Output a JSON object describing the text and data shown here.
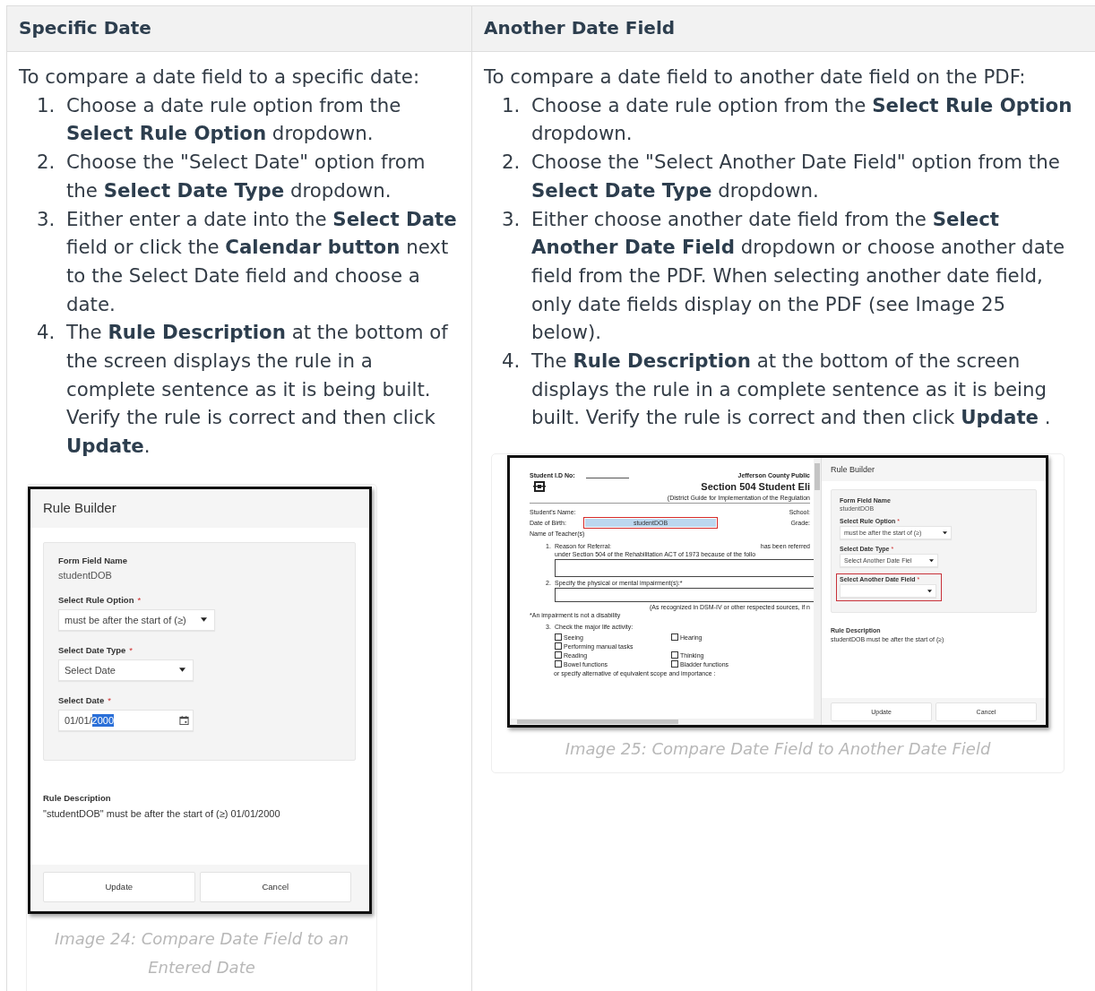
{
  "table": {
    "columns": [
      {
        "title": "Specific Date"
      },
      {
        "title": "Another Date Field"
      }
    ],
    "cells": [
      {
        "intro": "To compare a date field to a specific date:",
        "steps": [
          {
            "number": "1.",
            "text": "Choose a date rule option from the **Select Rule Option** dropdown."
          },
          {
            "number": "2.",
            "text": "Choose the \"Select Date\" option from the **Select Date Type** dropdown."
          },
          {
            "number": "3.",
            "text": "Either enter a date into the **Select Date** field or click the **Calendar button** next to the Select Date field and choose a date."
          },
          {
            "number": "4.",
            "text": "The **Rule Description** at the bottom of the screen displays the rule in a complete sentence as it is being built. Verify the rule is correct and then click **Update**."
          }
        ],
        "figure": {
          "kind": "dialog",
          "caption": "Image 24: Compare Date Field to an Entered Date",
          "dialog": {
            "title": "Rule Builder",
            "fields": [
              {
                "kind": "text",
                "label": "Form Field Name",
                "value": "studentDOB",
                "highlighted": false
              },
              {
                "kind": "select",
                "label": "Select Rule Option",
                "mark": "*",
                "value": "must be after the start of (≥)",
                "highlighted": false
              },
              {
                "kind": "select",
                "label": "Select Date Type",
                "mark": "*",
                "value": "Select Date",
                "highlighted": false
              },
              {
                "kind": "date",
                "label": "Select Date",
                "mark": "*",
                "value": "01/01/",
                "selected_text": "2000",
                "highlighted": false
              }
            ],
            "description_label": "Rule Description",
            "description": "\"studentDOB\" must be after the start of (≥) 01/01/2000",
            "buttons": [
              "Update",
              "Cancel"
            ]
          }
        }
      },
      {
        "intro": "To compare a date field to another date field on the PDF:",
        "steps": [
          {
            "number": "1.",
            "text": "Choose a date rule option from the **Select Rule Option** dropdown."
          },
          {
            "number": "2.",
            "text": "Choose the \"Select Another Date Field\" option from the **Select Date Type** dropdown."
          },
          {
            "number": "3.",
            "text": "Either choose another date field from the **Select Another Date Field** dropdown or choose another date field from the PDF. When selecting another date field, only date fields display on the PDF (see Image 25 below)."
          },
          {
            "number": "4.",
            "text": "The  **Rule Description**  at the bottom of the screen displays the rule in a complete sentence as it is being built. Verify the rule is correct and then click  **Update** ."
          }
        ],
        "figure": {
          "kind": "pdf_split",
          "caption": "Image 25: Compare Date Field to Another Date Field",
          "pdf": {
            "id_label": "Student I.D No:",
            "org": "Jefferson County Public",
            "title": "Section 504 Student Eli",
            "subtitle": "(District Guide for Implementation of the Regulation",
            "rows": [
              {
                "label": "Student's Name:",
                "right_label": "School:"
              },
              {
                "label": "Date of Birth:",
                "field": "studentDOB",
                "right_label": "Grade:"
              },
              {
                "label": "Name of Teacher(s)"
              }
            ],
            "q1": {
              "number": "1.",
              "label": "Reason for Referral:",
              "aside": "has been referred",
              "line2": "under Section 504 of the Rehabilitation ACT of 1973 because of the follo"
            },
            "q2": {
              "number": "2.",
              "label": "Specify the physical or mental impairment(s):*",
              "note": "(As recognized in DSM-IV or other respected sources, if n"
            },
            "disclaimer": "*An impairment is not a disability",
            "q3": {
              "number": "3.",
              "label": "Check the major life activity:",
              "options_left": [
                {
                  "label": "Seeing",
                  "checked": false
                },
                {
                  "label": "Performing manual tasks",
                  "checked": false
                },
                {
                  "label": "Reading",
                  "checked": false
                },
                {
                  "label": "Bowel functions",
                  "checked": false
                }
              ],
              "options_right": [
                {
                  "label": "Hearing",
                  "checked": false
                },
                {
                  "label": "Thinking",
                  "checked": false
                },
                {
                  "label": "Bladder functions",
                  "checked": false
                }
              ],
              "footer": "or specify alternative of equivalent scope and importance :"
            }
          },
          "dialog": {
            "title": "Rule Builder",
            "fields": [
              {
                "kind": "text",
                "label": "Form Field Name",
                "value": "studentDOB",
                "highlighted": false
              },
              {
                "kind": "select",
                "label": "Select Rule Option",
                "mark": "*",
                "value": "must be after the start of (≥)",
                "highlighted": false
              },
              {
                "kind": "select",
                "label": "Select Date Type",
                "mark": "*",
                "value": "Select Another Date Fiel",
                "highlighted": false
              },
              {
                "kind": "select",
                "label": "Select Another Date Field",
                "mark": "*",
                "highlighted": true
              }
            ],
            "description_label": "Rule Description",
            "description": "studentDOB must be after the start of (≥)",
            "buttons": [
              "Update",
              "Cancel"
            ]
          }
        }
      }
    ]
  }
}
